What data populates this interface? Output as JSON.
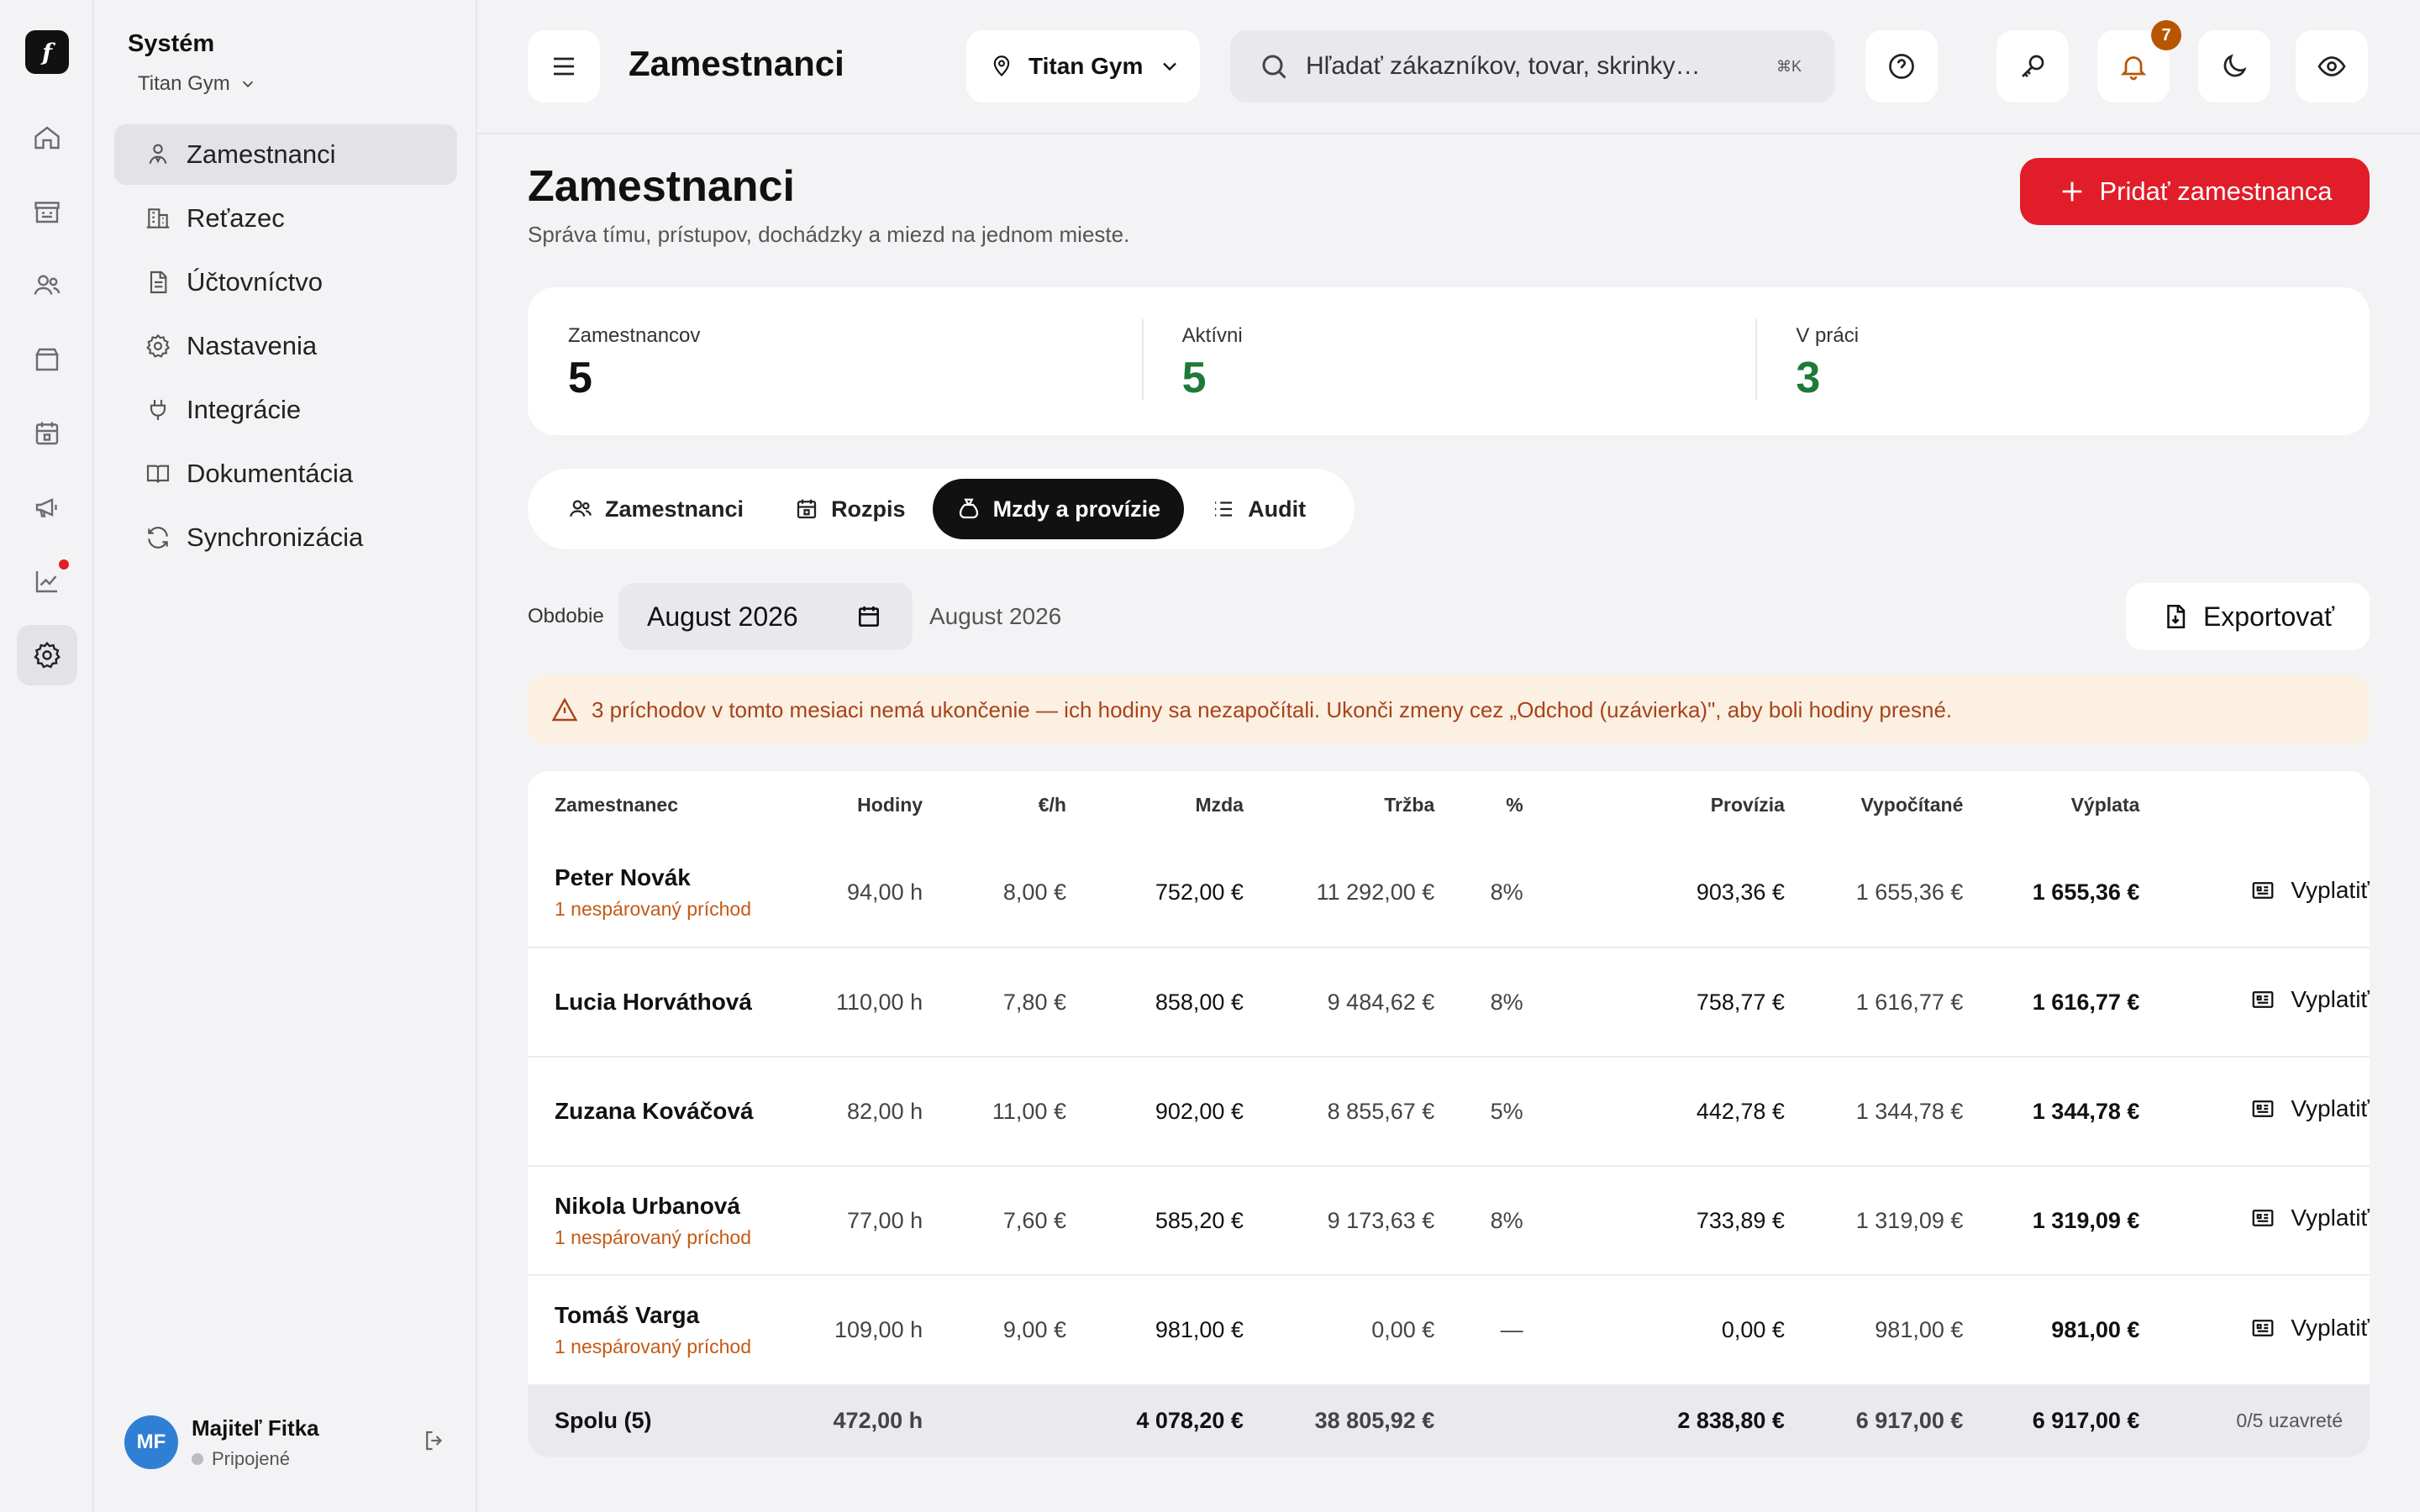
{
  "app": {
    "logo_glyph": "f",
    "rail_icons": [
      "home-icon",
      "store-icon",
      "users-icon",
      "box-icon",
      "calendar-icon",
      "megaphone-icon",
      "chart-icon",
      "settings-icon"
    ]
  },
  "sidebar": {
    "title": "Systém",
    "subtitle": "Titan Gym",
    "items": [
      {
        "label": "Zamestnanci",
        "icon": "employee-icon"
      },
      {
        "label": "Reťazec",
        "icon": "building-icon"
      },
      {
        "label": "Účtovníctvo",
        "icon": "document-icon"
      },
      {
        "label": "Nastavenia",
        "icon": "gear-icon"
      },
      {
        "label": "Integrácie",
        "icon": "plug-icon"
      },
      {
        "label": "Dokumentácia",
        "icon": "book-icon"
      },
      {
        "label": "Synchronizácia",
        "icon": "sync-icon"
      }
    ]
  },
  "user": {
    "initials": "MF",
    "name": "Majiteľ Fitka",
    "status": "Pripojené"
  },
  "topbar": {
    "title": "Zamestnanci",
    "location": "Titan Gym",
    "search_placeholder": "Hľadať zákazníkov, tovar, skrinky…",
    "search_shortcut": "⌘K",
    "notifications_count": "7"
  },
  "page": {
    "title": "Zamestnanci",
    "subtitle": "Správa tímu, prístupov, dochádzky a miezd na jednom mieste.",
    "add_button": "Pridať zamestnanca"
  },
  "stats": [
    {
      "label": "Zamestnancov",
      "value": "5"
    },
    {
      "label": "Aktívni",
      "value": "5"
    },
    {
      "label": "V práci",
      "value": "3"
    }
  ],
  "tabs": [
    {
      "label": "Zamestnanci"
    },
    {
      "label": "Rozpis"
    },
    {
      "label": "Mzdy a provízie"
    },
    {
      "label": "Audit"
    }
  ],
  "period": {
    "label": "Obdobie",
    "value": "August 2026",
    "display": "August 2026",
    "export_button": "Exportovať"
  },
  "warning": "3 príchodov v tomto mesiaci nemá ukončenie — ich hodiny sa nezapočítali. Ukonči zmeny cez „Odchod (uzávierka)\", aby boli hodiny presné.",
  "table": {
    "columns": [
      "Zamestnanec",
      "Hodiny",
      "€/h",
      "Mzda",
      "Tržba",
      "%",
      "Provízia",
      "Vypočítané",
      "Výplata"
    ],
    "pay_label": "Vyplatiť",
    "rows": [
      {
        "name": "Peter Novák",
        "warning": "1 nespárovaný príchod",
        "hours": "94,00 h",
        "rate": "8,00 €",
        "wage": "752,00 €",
        "revenue": "11 292,00 €",
        "pct": "8%",
        "commission": "903,36 €",
        "calculated": "1 655,36 €",
        "payout": "1 655,36 €"
      },
      {
        "name": "Lucia Horváthová",
        "warning": "",
        "hours": "110,00 h",
        "rate": "7,80 €",
        "wage": "858,00 €",
        "revenue": "9 484,62 €",
        "pct": "8%",
        "commission": "758,77 €",
        "calculated": "1 616,77 €",
        "payout": "1 616,77 €"
      },
      {
        "name": "Zuzana Kováčová",
        "warning": "",
        "hours": "82,00 h",
        "rate": "11,00 €",
        "wage": "902,00 €",
        "revenue": "8 855,67 €",
        "pct": "5%",
        "commission": "442,78 €",
        "calculated": "1 344,78 €",
        "payout": "1 344,78 €"
      },
      {
        "name": "Nikola Urbanová",
        "warning": "1 nespárovaný príchod",
        "hours": "77,00 h",
        "rate": "7,60 €",
        "wage": "585,20 €",
        "revenue": "9 173,63 €",
        "pct": "8%",
        "commission": "733,89 €",
        "calculated": "1 319,09 €",
        "payout": "1 319,09 €"
      },
      {
        "name": "Tomáš Varga",
        "warning": "1 nespárovaný príchod",
        "hours": "109,00 h",
        "rate": "9,00 €",
        "wage": "981,00 €",
        "revenue": "0,00 €",
        "pct": "—",
        "commission": "0,00 €",
        "calculated": "981,00 €",
        "payout": "981,00 €"
      }
    ],
    "total": {
      "label": "Spolu (5)",
      "hours": "472,00 h",
      "wage": "4 078,20 €",
      "revenue": "38 805,92 €",
      "commission": "2 838,80 €",
      "calculated": "6 917,00 €",
      "payout": "6 917,00 €",
      "closed": "0/5 uzavreté"
    }
  },
  "colors": {
    "accent": "#e11d2a",
    "positive": "#1f7a3a",
    "warning": "#a8431a",
    "warning_bg": "#fbf0e2",
    "badge": "#b85600"
  }
}
